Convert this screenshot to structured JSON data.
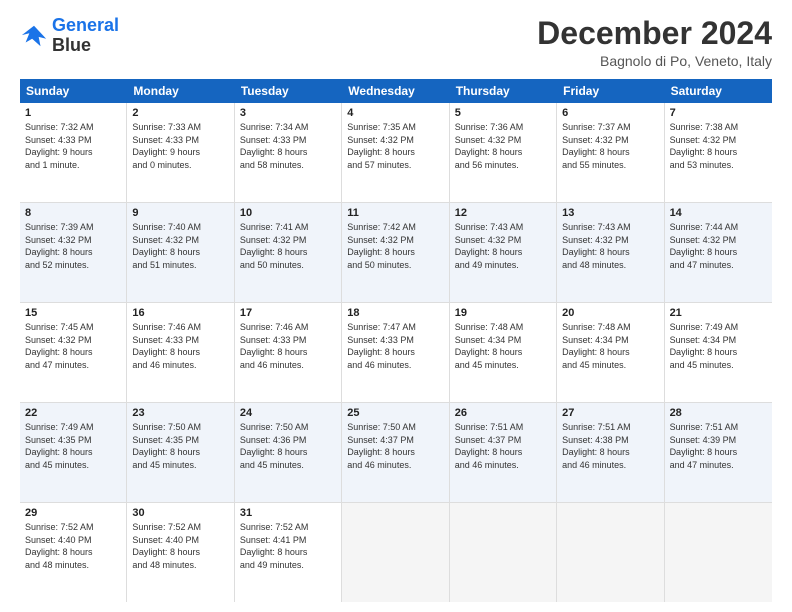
{
  "header": {
    "logo_line1": "General",
    "logo_line2": "Blue",
    "month": "December 2024",
    "location": "Bagnolo di Po, Veneto, Italy"
  },
  "days_of_week": [
    "Sunday",
    "Monday",
    "Tuesday",
    "Wednesday",
    "Thursday",
    "Friday",
    "Saturday"
  ],
  "weeks": [
    [
      {
        "day": "1",
        "info": "Sunrise: 7:32 AM\nSunset: 4:33 PM\nDaylight: 9 hours\nand 1 minute."
      },
      {
        "day": "2",
        "info": "Sunrise: 7:33 AM\nSunset: 4:33 PM\nDaylight: 9 hours\nand 0 minutes."
      },
      {
        "day": "3",
        "info": "Sunrise: 7:34 AM\nSunset: 4:33 PM\nDaylight: 8 hours\nand 58 minutes."
      },
      {
        "day": "4",
        "info": "Sunrise: 7:35 AM\nSunset: 4:32 PM\nDaylight: 8 hours\nand 57 minutes."
      },
      {
        "day": "5",
        "info": "Sunrise: 7:36 AM\nSunset: 4:32 PM\nDaylight: 8 hours\nand 56 minutes."
      },
      {
        "day": "6",
        "info": "Sunrise: 7:37 AM\nSunset: 4:32 PM\nDaylight: 8 hours\nand 55 minutes."
      },
      {
        "day": "7",
        "info": "Sunrise: 7:38 AM\nSunset: 4:32 PM\nDaylight: 8 hours\nand 53 minutes."
      }
    ],
    [
      {
        "day": "8",
        "info": "Sunrise: 7:39 AM\nSunset: 4:32 PM\nDaylight: 8 hours\nand 52 minutes."
      },
      {
        "day": "9",
        "info": "Sunrise: 7:40 AM\nSunset: 4:32 PM\nDaylight: 8 hours\nand 51 minutes."
      },
      {
        "day": "10",
        "info": "Sunrise: 7:41 AM\nSunset: 4:32 PM\nDaylight: 8 hours\nand 50 minutes."
      },
      {
        "day": "11",
        "info": "Sunrise: 7:42 AM\nSunset: 4:32 PM\nDaylight: 8 hours\nand 50 minutes."
      },
      {
        "day": "12",
        "info": "Sunrise: 7:43 AM\nSunset: 4:32 PM\nDaylight: 8 hours\nand 49 minutes."
      },
      {
        "day": "13",
        "info": "Sunrise: 7:43 AM\nSunset: 4:32 PM\nDaylight: 8 hours\nand 48 minutes."
      },
      {
        "day": "14",
        "info": "Sunrise: 7:44 AM\nSunset: 4:32 PM\nDaylight: 8 hours\nand 47 minutes."
      }
    ],
    [
      {
        "day": "15",
        "info": "Sunrise: 7:45 AM\nSunset: 4:32 PM\nDaylight: 8 hours\nand 47 minutes."
      },
      {
        "day": "16",
        "info": "Sunrise: 7:46 AM\nSunset: 4:33 PM\nDaylight: 8 hours\nand 46 minutes."
      },
      {
        "day": "17",
        "info": "Sunrise: 7:46 AM\nSunset: 4:33 PM\nDaylight: 8 hours\nand 46 minutes."
      },
      {
        "day": "18",
        "info": "Sunrise: 7:47 AM\nSunset: 4:33 PM\nDaylight: 8 hours\nand 46 minutes."
      },
      {
        "day": "19",
        "info": "Sunrise: 7:48 AM\nSunset: 4:34 PM\nDaylight: 8 hours\nand 45 minutes."
      },
      {
        "day": "20",
        "info": "Sunrise: 7:48 AM\nSunset: 4:34 PM\nDaylight: 8 hours\nand 45 minutes."
      },
      {
        "day": "21",
        "info": "Sunrise: 7:49 AM\nSunset: 4:34 PM\nDaylight: 8 hours\nand 45 minutes."
      }
    ],
    [
      {
        "day": "22",
        "info": "Sunrise: 7:49 AM\nSunset: 4:35 PM\nDaylight: 8 hours\nand 45 minutes."
      },
      {
        "day": "23",
        "info": "Sunrise: 7:50 AM\nSunset: 4:35 PM\nDaylight: 8 hours\nand 45 minutes."
      },
      {
        "day": "24",
        "info": "Sunrise: 7:50 AM\nSunset: 4:36 PM\nDaylight: 8 hours\nand 45 minutes."
      },
      {
        "day": "25",
        "info": "Sunrise: 7:50 AM\nSunset: 4:37 PM\nDaylight: 8 hours\nand 46 minutes."
      },
      {
        "day": "26",
        "info": "Sunrise: 7:51 AM\nSunset: 4:37 PM\nDaylight: 8 hours\nand 46 minutes."
      },
      {
        "day": "27",
        "info": "Sunrise: 7:51 AM\nSunset: 4:38 PM\nDaylight: 8 hours\nand 46 minutes."
      },
      {
        "day": "28",
        "info": "Sunrise: 7:51 AM\nSunset: 4:39 PM\nDaylight: 8 hours\nand 47 minutes."
      }
    ],
    [
      {
        "day": "29",
        "info": "Sunrise: 7:52 AM\nSunset: 4:40 PM\nDaylight: 8 hours\nand 48 minutes."
      },
      {
        "day": "30",
        "info": "Sunrise: 7:52 AM\nSunset: 4:40 PM\nDaylight: 8 hours\nand 48 minutes."
      },
      {
        "day": "31",
        "info": "Sunrise: 7:52 AM\nSunset: 4:41 PM\nDaylight: 8 hours\nand 49 minutes."
      },
      {
        "day": "",
        "info": ""
      },
      {
        "day": "",
        "info": ""
      },
      {
        "day": "",
        "info": ""
      },
      {
        "day": "",
        "info": ""
      }
    ]
  ]
}
